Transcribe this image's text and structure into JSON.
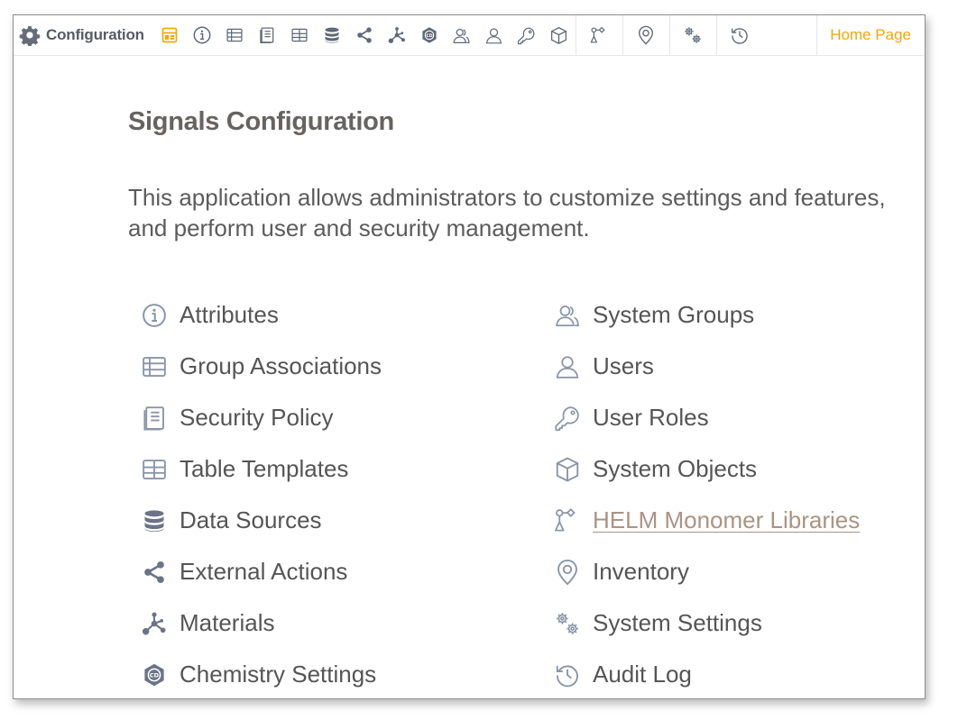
{
  "app": {
    "title": "Configuration",
    "brand_icon": "gear-icon",
    "home_link": "Home Page"
  },
  "colors": {
    "accent": "#f2a60c",
    "icon": "#8a95a8",
    "icon_dark": "#6b7487",
    "link": "#a99484",
    "title": "#666360",
    "text": "#5c5c5c"
  },
  "toolbar": {
    "icons": [
      "layout-icon",
      "info-icon",
      "table-icon",
      "book-icon",
      "table-template-icon",
      "database-icon",
      "share-icon",
      "molecule-icon",
      "cd-hexagon-icon",
      "group-icon",
      "user-icon",
      "key-icon",
      "cube-icon",
      "monomer-icon",
      "location-icon",
      "gears-icon",
      "history-icon"
    ]
  },
  "main": {
    "title": "Signals Configuration",
    "description": "This application allows administrators to customize settings and features, and perform user and security management.",
    "left_items": [
      {
        "label": "Attributes",
        "icon": "info-icon"
      },
      {
        "label": "Group Associations",
        "icon": "table-icon"
      },
      {
        "label": "Security Policy",
        "icon": "book-icon"
      },
      {
        "label": "Table Templates",
        "icon": "table-template-icon"
      },
      {
        "label": "Data Sources",
        "icon": "database-icon"
      },
      {
        "label": "External Actions",
        "icon": "share-icon"
      },
      {
        "label": "Materials",
        "icon": "molecule-icon"
      },
      {
        "label": "Chemistry Settings",
        "icon": "cd-hexagon-icon"
      }
    ],
    "right_items": [
      {
        "label": "System Groups",
        "icon": "group-icon"
      },
      {
        "label": "Users",
        "icon": "user-icon"
      },
      {
        "label": "User Roles",
        "icon": "key-icon"
      },
      {
        "label": "System Objects",
        "icon": "cube-icon"
      },
      {
        "label": "HELM Monomer Libraries",
        "icon": "monomer-icon"
      },
      {
        "label": "Inventory",
        "icon": "location-icon"
      },
      {
        "label": "System Settings",
        "icon": "gears-icon"
      },
      {
        "label": "Audit Log",
        "icon": "history-icon"
      }
    ]
  }
}
